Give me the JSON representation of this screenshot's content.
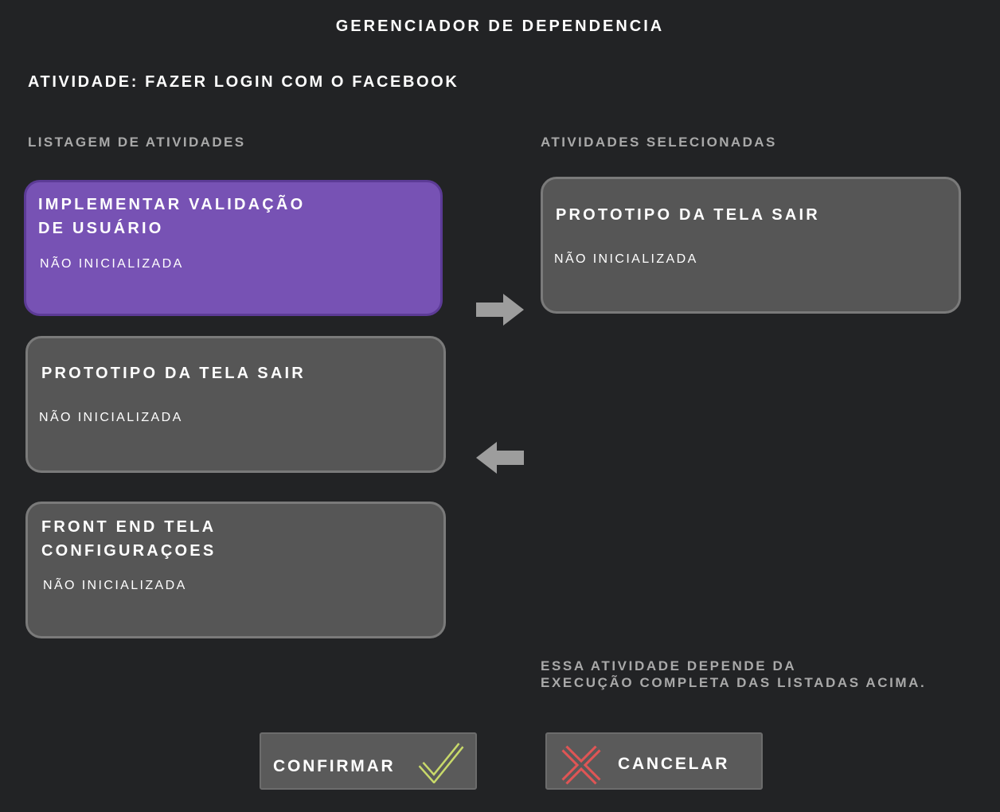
{
  "window": {
    "title": "GERENCIADOR DE DEPENDENCIA",
    "activity": "ATIVIDADE: FAZER LOGIN COM O FACEBOOK"
  },
  "list": {
    "label": "LISTAGEM DE ATIVIDADES",
    "items": [
      {
        "title": "IMPLEMENTAR VALIDAÇÃO\nDE USUÁRIO",
        "status": "NÃO INICIALIZADA",
        "selected": true
      },
      {
        "title": "PROTOTIPO DA TELA SAIR",
        "status": "NÃO INICIALIZADA",
        "selected": false
      },
      {
        "title": "FRONT END TELA\nCONFIGURAÇOES",
        "status": "NÃO INICIALIZADA",
        "selected": false
      }
    ]
  },
  "selected_list": {
    "label": "ATIVIDADES SELECIONADAS",
    "items": [
      {
        "title": "PROTOTIPO DA TELA SAIR",
        "status": "NÃO INICIALIZADA"
      }
    ]
  },
  "icons": {
    "add": "arrow-right-icon",
    "remove": "arrow-left-icon",
    "confirm": "check-icon",
    "cancel": "x-icon"
  },
  "note": {
    "line1": "ESSA ATIVIDADE DEPENDE DA",
    "line2": "EXECUÇÃO COMPLETA DAS LISTADAS ACIMA."
  },
  "buttons": {
    "confirm_label": "CONFIRMAR",
    "cancel_label": "CANCELAR"
  },
  "colors": {
    "background": "#222325",
    "card": "#565656",
    "card_selected": "#7752b4",
    "check": "#c8d96a",
    "cancel_x": "#e05555"
  }
}
